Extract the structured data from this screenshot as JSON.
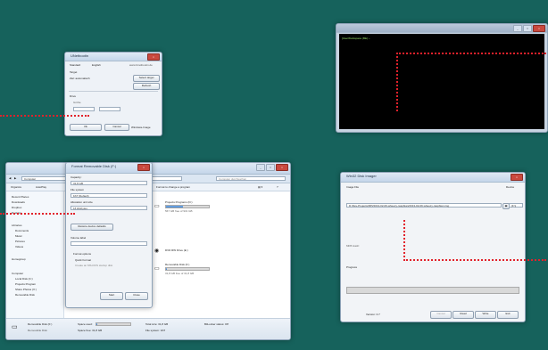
{
  "unetbootin": {
    "title": "UNetbootin",
    "radio_distribution": "Standard",
    "radio_english": "English",
    "link": "www.Unetbootin.de",
    "target_label": "Target",
    "target_value": "Ziel: automatisch",
    "select_target": "Select target",
    "refresh": "Refresh",
    "drive_label": "Drive",
    "size_option": "Größe",
    "ok": "Ok",
    "cancel": "Cancel",
    "checkbox": "Windows-Image"
  },
  "terminal": {
    "prompt": "[UserWorkspace (BE) ~"
  },
  "explorer": {
    "address": "Computer",
    "toolbar_organize": "Organize",
    "toolbar_autoplay": "AutoPlay",
    "search_hint": "Computer durchsuchen",
    "sidebar": [
      "Recent Places",
      "Downloads",
      "Dropbox",
      "Desktop",
      "",
      "Libraries",
      "Documents",
      "Music",
      "Pictures",
      "Videos",
      "",
      "Homegroup",
      "",
      "Computer",
      "Local Disk (C:)",
      "Projects Program",
      "Share Photos (X:)",
      "Removable Disk"
    ],
    "toolbar_right": "Format to change a program",
    "drives": [
      {
        "name": "Projects Programs (D:)",
        "sub": "567 GB free of 931 GB",
        "fill": 0.4
      },
      {
        "name": "DVD RW Drive (E:)",
        "sub": "",
        "fill": 0
      },
      {
        "name": "Removable Disk (F:)",
        "sub": "31,8 GB free of 31,8 GB",
        "fill": 0.02
      }
    ],
    "status": {
      "device": "Removable Disk (F:)",
      "type": "Removable Disk",
      "space_used_label": "Space used:",
      "total_label": "Total size: 31,8 GB",
      "space_free_label": "Space free: 31,8 GB",
      "file_system": "File system: FAT",
      "bitlocker": "BitLocker status: Off"
    }
  },
  "format_dialog": {
    "title": "Format Removable Disk (F:)",
    "capacity_label": "Capacity:",
    "capacity_value": "31,8 GB",
    "fs_label": "File system",
    "fs_value": "FAT (Default)",
    "alloc_label": "Allocation unit size",
    "alloc_value": "16 kilobytes",
    "restore": "Restore device defaults",
    "volume_label": "Volume label",
    "format_options": "Format options",
    "quick_format": "Quick Format",
    "msdos": "Create an MS-DOS startup disk",
    "start": "Start",
    "close": "Close"
  },
  "win32_imager": {
    "title": "Win32 Disk Imager",
    "image_file_label": "Image File",
    "device_label": "Device",
    "image_path": "D:/Dev-Projects/RPi/2013-02-09-wheezy-raspbian/2013-02-09-wheezy-raspbian.img",
    "device_value": "[F:\\]",
    "md5_label": "MD5 Hash:",
    "progress_label": "Progress",
    "version": "Version: 0.7",
    "cancel": "Cancel",
    "read": "Read",
    "write": "Write",
    "exit": "Exit"
  }
}
